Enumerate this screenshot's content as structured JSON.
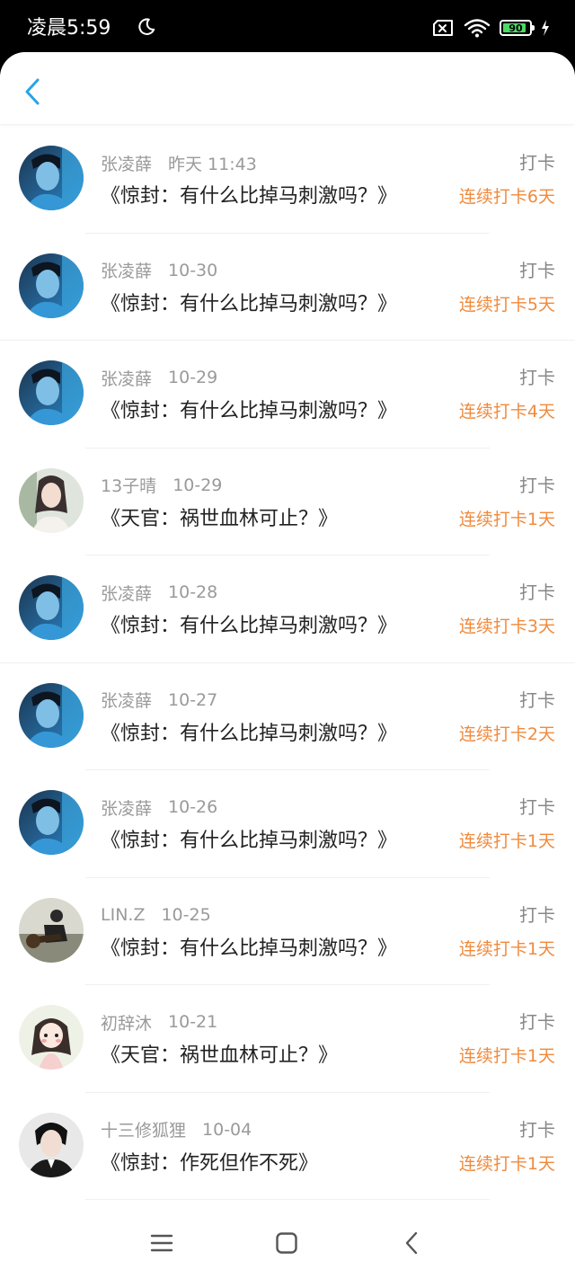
{
  "status_bar": {
    "time": "凌晨5:59",
    "battery": "90",
    "battery_level": 0.9
  },
  "colors": {
    "accent": "#2aa3e6",
    "streak": "#f08a3c"
  },
  "header": {
    "back_icon": "chevron-left-icon"
  },
  "list": [
    {
      "name": "张凌薛",
      "time": "昨天 11:43",
      "title": "《惊封：有什么比掉马刺激吗？》",
      "action": "打卡",
      "streak": "连续打卡6天",
      "avatar": "avatar-a"
    },
    {
      "name": "张凌薛",
      "time": "10-30",
      "title": "《惊封：有什么比掉马刺激吗？》",
      "action": "打卡",
      "streak": "连续打卡5天",
      "avatar": "avatar-a"
    },
    {
      "name": "张凌薛",
      "time": "10-29",
      "title": "《惊封：有什么比掉马刺激吗？》",
      "action": "打卡",
      "streak": "连续打卡4天",
      "avatar": "avatar-a"
    },
    {
      "name": "13子晴",
      "time": "10-29",
      "title": "《天官：祸世血林可止？》",
      "action": "打卡",
      "streak": "连续打卡1天",
      "avatar": "avatar-b"
    },
    {
      "name": "张凌薛",
      "time": "10-28",
      "title": "《惊封：有什么比掉马刺激吗？》",
      "action": "打卡",
      "streak": "连续打卡3天",
      "avatar": "avatar-a"
    },
    {
      "name": "张凌薛",
      "time": "10-27",
      "title": "《惊封：有什么比掉马刺激吗？》",
      "action": "打卡",
      "streak": "连续打卡2天",
      "avatar": "avatar-a"
    },
    {
      "name": "张凌薛",
      "time": "10-26",
      "title": "《惊封：有什么比掉马刺激吗？》",
      "action": "打卡",
      "streak": "连续打卡1天",
      "avatar": "avatar-a"
    },
    {
      "name": "LIN.Z",
      "time": "10-25",
      "title": "《惊封：有什么比掉马刺激吗？》",
      "action": "打卡",
      "streak": "连续打卡1天",
      "avatar": "avatar-c"
    },
    {
      "name": "初辞沐",
      "time": "10-21",
      "title": "《天官：祸世血林可止？》",
      "action": "打卡",
      "streak": "连续打卡1天",
      "avatar": "avatar-d"
    },
    {
      "name": "十三修狐狸",
      "time": "10-04",
      "title": "《惊封：作死但作不死》",
      "action": "打卡",
      "streak": "连续打卡1天",
      "avatar": "avatar-e"
    }
  ],
  "nav": {
    "menu_icon": "menu-icon",
    "home_icon": "home-icon",
    "back_icon": "back-icon"
  }
}
